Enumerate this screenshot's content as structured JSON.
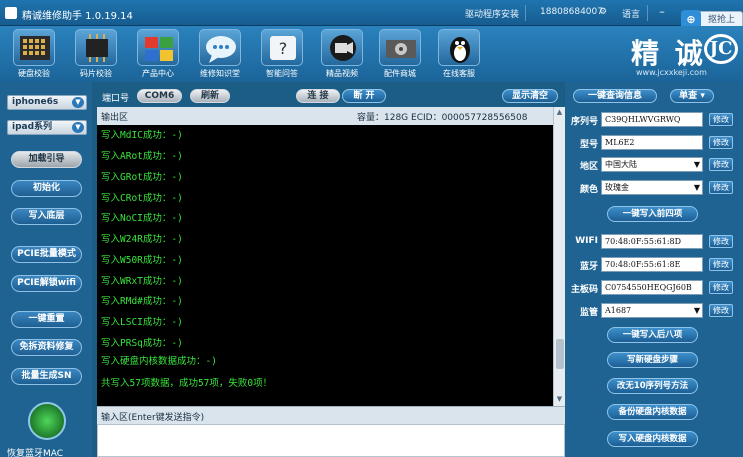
{
  "titlebar": {
    "title": "精诚维修助手 1.0.19.14",
    "driver_install": "驱动程序安装",
    "phone": "18808684007",
    "language": "语言",
    "share": "抠抢上网"
  },
  "toolbar": {
    "tools": [
      {
        "label": "硬盘校验",
        "icon": "disk-chip-icon"
      },
      {
        "label": "码片校验",
        "icon": "chip-icon"
      },
      {
        "label": "产品中心",
        "icon": "product-blocks-icon"
      },
      {
        "label": "维修知识堂",
        "icon": "chat-bubble-icon"
      },
      {
        "label": "智能问答",
        "icon": "qa-icon"
      },
      {
        "label": "精品视频",
        "icon": "video-camera-icon"
      },
      {
        "label": "配件商城",
        "icon": "parts-shop-icon"
      },
      {
        "label": "在线客服",
        "icon": "penguin-service-icon"
      }
    ],
    "brand_text": "精 诚",
    "brand_mark": "JC",
    "brand_url": "www.jcxxkeji.com"
  },
  "left": {
    "device_select": "iphone6s",
    "series_select": "ipad系列",
    "buttons": [
      "加载引导",
      "初始化",
      "写入底层",
      "PCIE批量模式",
      "PCIE解锁wifi",
      "一键重置",
      "免拆资料修复",
      "批量生成SN"
    ],
    "radar_label": "恢复蓝牙MAC"
  },
  "controls": {
    "port_label": "端口号",
    "port_value": "COM6",
    "refresh": "刷新",
    "connect": "连 接",
    "disconnect": "断 开",
    "show_clear": "显示清空"
  },
  "output": {
    "header": "输出区",
    "capacity": "容量：128G  ECID：000057728556508",
    "lines": [
      "写入MdIC成功：-)",
      "写入ARot成功：-)",
      "写入GRot成功：-)",
      "写入CRot成功：-)",
      "写入NoCI成功：-)",
      "写入W24R成功：-)",
      "写入W50R成功：-)",
      "写入WRxT成功：-)",
      "写入RMd#成功：-)",
      "写入LSCI成功：-)",
      "写入PRSq成功：-)",
      "写入硬盘内核数据成功：-)",
      "共写入57项数据，成功57项，失败0项！"
    ]
  },
  "input": {
    "header": "输入区(Enter键发送指令)"
  },
  "right": {
    "query_button": "一键查询信息",
    "single_button": "单查",
    "fields": [
      {
        "label": "序列号",
        "value": "C39QHLWVGRWQ",
        "dropdown": false
      },
      {
        "label": "型号",
        "value": "ML6E2",
        "dropdown": false
      },
      {
        "label": "地区",
        "value": "中国大陆",
        "dropdown": true
      },
      {
        "label": "颜色",
        "value": "玫瑰金",
        "dropdown": true
      }
    ],
    "write_four": "一键写入前四项",
    "fields2": [
      {
        "label": "WIFI",
        "value": "70:48:0F:55:61:8D"
      },
      {
        "label": "蓝牙",
        "value": "70:48:0F:55:61:8E"
      },
      {
        "label": "主板码",
        "value": "C0754550HEQGJ60B"
      },
      {
        "label": "监管",
        "value": "A1687",
        "dropdown": true
      }
    ],
    "modify": "修改",
    "buttons": [
      "一键写入后八项",
      "写新硬盘步骤",
      "改无10序列号方法",
      "备份硬盘内核数据",
      "写入硬盘内核数据"
    ]
  }
}
